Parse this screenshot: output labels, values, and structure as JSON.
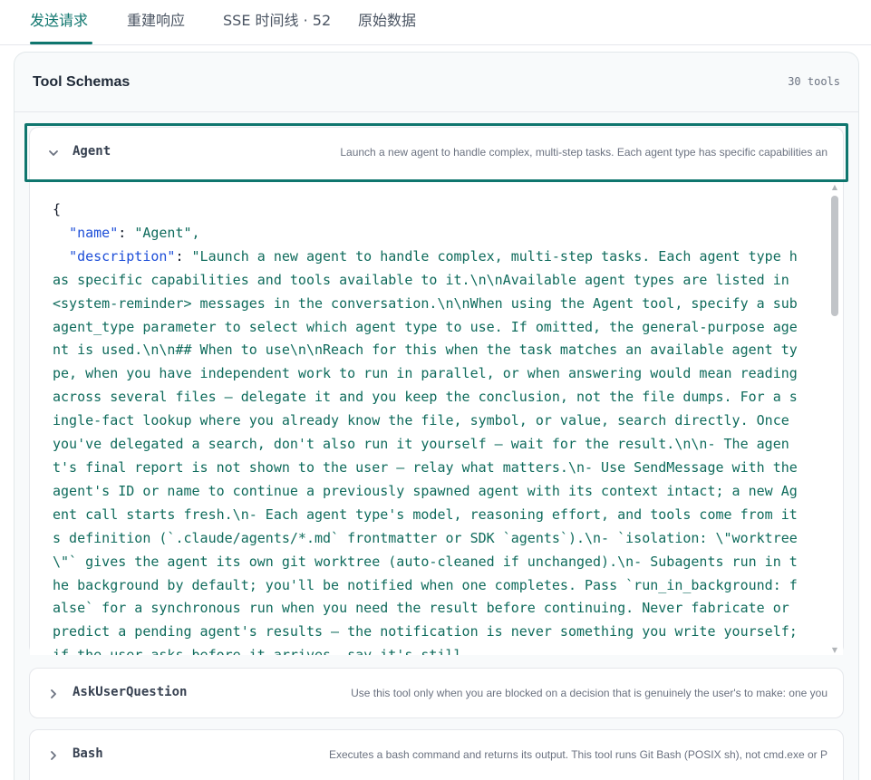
{
  "tabs": [
    {
      "label": "发送请求",
      "active": true
    },
    {
      "label": "重建响应",
      "active": false
    },
    {
      "label": "SSE 时间线 · 52",
      "active": false
    },
    {
      "label": "原始数据",
      "active": false
    }
  ],
  "panel": {
    "title": "Tool Schemas",
    "count": "30 tools"
  },
  "tools": [
    {
      "name": "Agent",
      "description": "Launch a new agent to handle complex, multi-step tasks. Each agent type has specific capabilities an",
      "expanded": true,
      "icon": "chevron-down-icon"
    },
    {
      "name": "AskUserQuestion",
      "description": "Use this tool only when you are blocked on a decision that is genuinely the user's to make: one you",
      "expanded": false,
      "icon": "chevron-right-icon"
    },
    {
      "name": "Bash",
      "description": "Executes a bash command and returns its output. This tool runs Git Bash (POSIX sh), not cmd.exe or P",
      "expanded": false,
      "icon": "chevron-right-icon"
    }
  ],
  "schema": {
    "open_brace": "{",
    "name_key": "\"name\"",
    "name_value": "\"Agent\",",
    "desc_key": "\"description\"",
    "desc_value": "\"Launch a new agent to handle complex, multi-step tasks. Each agent type has specific capabilities and tools available to it.\\n\\nAvailable agent types are listed in <system-reminder> messages in the conversation.\\n\\nWhen using the Agent tool, specify a subagent_type parameter to select which agent type to use. If omitted, the general-purpose agent is used.\\n\\n## When to use\\n\\nReach for this when the task matches an available agent type, when you have independent work to run in parallel, or when answering would mean reading across several files — delegate it and you keep the conclusion, not the file dumps. For a single-fact lookup where you already know the file, symbol, or value, search directly. Once you've delegated a search, don't also run it yourself — wait for the result.\\n\\n- The agent's final report is not shown to the user — relay what matters.\\n- Use SendMessage with the agent's ID or name to continue a previously spawned agent with its context intact; a new Agent call starts fresh.\\n- Each agent type's model, reasoning effort, and tools come from its definition (`.claude/agents/*.md` frontmatter or SDK `agents`).\\n- `isolation: \\\"worktree\\\"` gives the agent its own git worktree (auto-cleaned if unchanged).\\n- Subagents run in the background by default; you'll be notified when one completes. Pass `run_in_background: false` for a synchronous run when you need the result before continuing. Never fabricate or predict a pending agent's results — the notification is never something you write yourself; if the user asks before it arrives, say it's still"
  },
  "colors": {
    "accent": "#0f766e",
    "json_string": "#0f6b5c",
    "json_key": "#1d4ed8"
  }
}
